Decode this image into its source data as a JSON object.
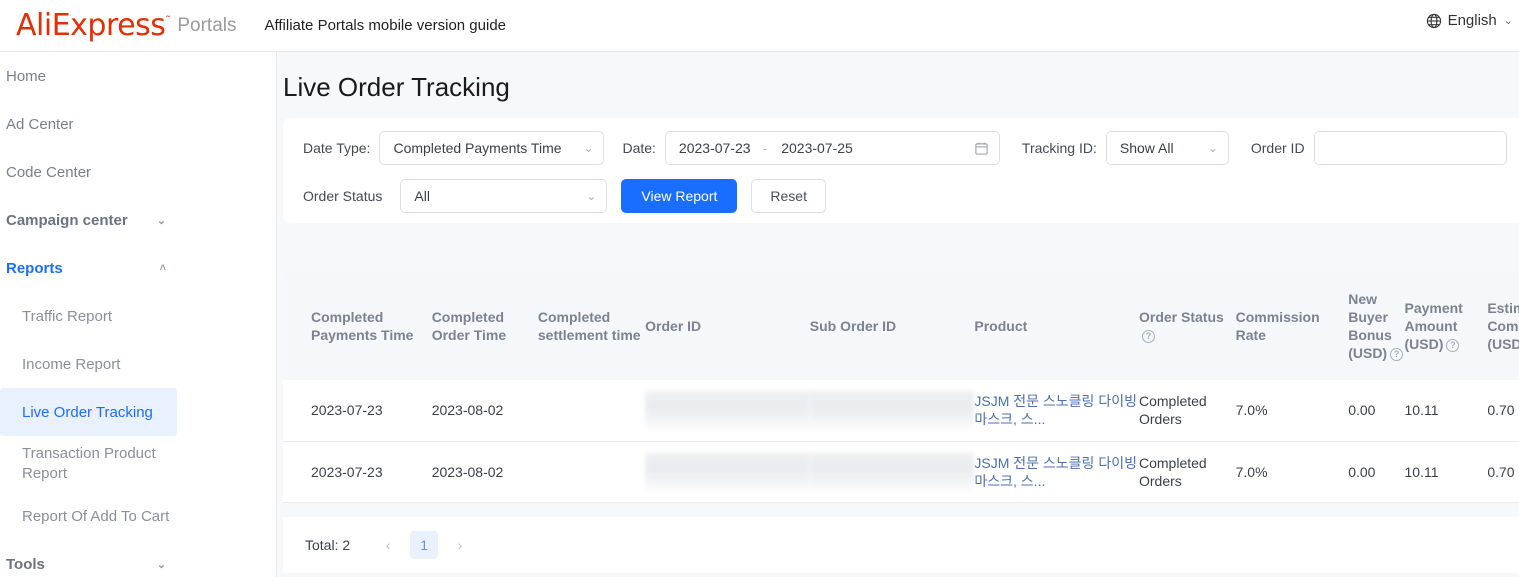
{
  "header": {
    "logo": "AliExpress",
    "logo_tm": "˜",
    "portals": "Portals",
    "guide_link": "Affiliate Portals mobile version guide",
    "language": "English",
    "lang_caret": "⌄",
    "globe_icon": "globe-icon"
  },
  "sidebar": {
    "items": [
      {
        "label": "Home",
        "type": "link"
      },
      {
        "label": "Ad Center",
        "type": "link"
      },
      {
        "label": "Code Center",
        "type": "link"
      },
      {
        "label": "Campaign center",
        "type": "group",
        "caret": "⌄"
      },
      {
        "label": "Reports",
        "type": "group-active",
        "caret": "˄"
      },
      {
        "label": "Traffic Report",
        "type": "sub"
      },
      {
        "label": "Income Report",
        "type": "sub"
      },
      {
        "label": "Live Order Tracking",
        "type": "sub-selected"
      },
      {
        "label": "Transaction Product Report",
        "type": "sub"
      },
      {
        "label": "Report Of Add To Cart",
        "type": "sub"
      },
      {
        "label": "Tools",
        "type": "group",
        "caret": "⌄"
      }
    ]
  },
  "page": {
    "title": "Live Order Tracking"
  },
  "filters": {
    "date_type_label": "Date Type:",
    "date_type_value": "Completed Payments Time",
    "date_label": "Date:",
    "date_start": "2023-07-23",
    "date_separator": "-",
    "date_end": "2023-07-25",
    "calendar_icon": "calendar-icon",
    "tracking_id_label": "Tracking ID:",
    "tracking_id_value": "Show All",
    "order_id_label": "Order ID",
    "order_id_value": "",
    "order_id_placeholder": "",
    "order_status_label": "Order Status",
    "order_status_value": "All",
    "view_report_button": "View Report",
    "reset_button": "Reset",
    "caret": "⌄",
    "primary_color": "#1a6eff"
  },
  "table": {
    "columns": [
      {
        "label": "Completed Payments Time",
        "help": false,
        "width": 140
      },
      {
        "label": "Completed Order Time",
        "help": false,
        "width": 100
      },
      {
        "label": "Completed settlement time",
        "help": false,
        "width": 101
      },
      {
        "label": "Order ID",
        "help": false,
        "width": 155
      },
      {
        "label": "Sub Order ID",
        "help": false,
        "width": 155
      },
      {
        "label": "Product",
        "help": false,
        "width": 155
      },
      {
        "label": "Order Status",
        "help": true,
        "width": 91
      },
      {
        "label": "Commission Rate",
        "help": false,
        "width": 106
      },
      {
        "label": "New Buyer Bonus (USD)",
        "help": true,
        "width": 53
      },
      {
        "label": "Payment Amount (USD)",
        "help": true,
        "width": 78
      },
      {
        "label": "Estimated Commiss.. (USD)",
        "help": false,
        "width": 90
      }
    ],
    "help_glyph": "?",
    "rows": [
      {
        "completed_payments_time": "2023-07-23",
        "completed_order_time": "2023-08-02",
        "completed_settlement_time": "",
        "order_id": "",
        "sub_order_id": "",
        "product": "JSJM 전문 스노클링 다이빙 마스크, 스...",
        "order_status": "Completed Orders",
        "commission_rate": "7.0%",
        "new_buyer_bonus": "0.00",
        "payment_amount": "10.11",
        "estimated_commission": "0.70"
      },
      {
        "completed_payments_time": "2023-07-23",
        "completed_order_time": "2023-08-02",
        "completed_settlement_time": "",
        "order_id": "",
        "sub_order_id": "",
        "product": "JSJM 전문 스노클링 다이빙 마스크, 스...",
        "order_status": "Completed Orders",
        "commission_rate": "7.0%",
        "new_buyer_bonus": "0.00",
        "payment_amount": "10.11",
        "estimated_commission": "0.70"
      }
    ]
  },
  "pagination": {
    "total_label": "Total: 2",
    "prev": "‹",
    "current_page": "1",
    "next": "›"
  }
}
